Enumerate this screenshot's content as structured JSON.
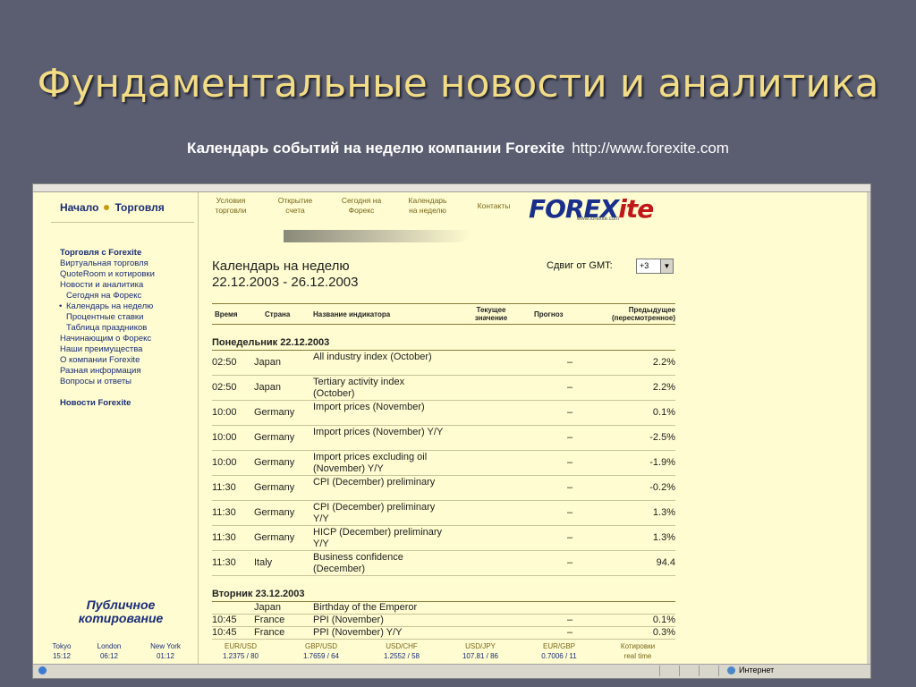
{
  "slide": {
    "title": "Фундаментальные новости и аналитика",
    "subtitle_bold": "Календарь событий на неделю компании Forexite",
    "subtitle_url": "http://www.forexite.com"
  },
  "site": {
    "topnav": [
      "Начало",
      "Торговля"
    ],
    "topmenu": [
      [
        "Условия",
        "торговли"
      ],
      [
        "Открытие",
        "счета"
      ],
      [
        "Сегодня на",
        "Форекс"
      ],
      [
        "Календарь",
        "на неделю"
      ],
      [
        "Контакты",
        ""
      ]
    ],
    "logo": {
      "main": "FOREX",
      "accent": "ite",
      "small": "www.forexite.com"
    },
    "leftmenu": [
      "Торговля с Forexite",
      "Виртуальная торговля",
      "QuoteRoom и котировки",
      "Новости и аналитика",
      "Сегодня на Форекс",
      "Календарь на неделю",
      "Процентные ставки",
      "Таблица праздников",
      "Начинающим о Форекс",
      "Наши преимущества",
      "О компании Forexite",
      "Разная информация",
      "Вопросы и ответы"
    ],
    "news_link": "Новости Forexite",
    "pub_quote": [
      "Публичное",
      "котирование"
    ],
    "page_title": "Календарь на неделю",
    "page_dates": "22.12.2003 - 26.12.2003",
    "gmt_label": "Сдвиг от GMT:",
    "gmt_value": "+3",
    "table_headers": {
      "time": "Время",
      "country": "Страна",
      "indicator": "Название индикатора",
      "current": [
        "Текущее",
        "значение"
      ],
      "forecast": "Прогноз",
      "previous": [
        "Предыдущее",
        "(пересмотренное)"
      ]
    },
    "days": [
      {
        "label": "Понедельник 22.12.2003",
        "rows": [
          {
            "time": "02:50",
            "country": "Japan",
            "indicator": "All industry index (October)",
            "forecast": "–",
            "previous": "2.2%"
          },
          {
            "time": "02:50",
            "country": "Japan",
            "indicator": "Tertiary activity index (October)",
            "forecast": "–",
            "previous": "2.2%"
          },
          {
            "time": "10:00",
            "country": "Germany",
            "indicator": "Import prices (November)",
            "forecast": "–",
            "previous": "0.1%"
          },
          {
            "time": "10:00",
            "country": "Germany",
            "indicator": "Import prices (November) Y/Y",
            "forecast": "–",
            "previous": "-2.5%"
          },
          {
            "time": "10:00",
            "country": "Germany",
            "indicator": "Import prices excluding oil (November) Y/Y",
            "forecast": "–",
            "previous": "-1.9%"
          },
          {
            "time": "11:30",
            "country": "Germany",
            "indicator": "CPI (December) preliminary",
            "forecast": "–",
            "previous": "-0.2%"
          },
          {
            "time": "11:30",
            "country": "Germany",
            "indicator": "CPI (December) preliminary Y/Y",
            "forecast": "–",
            "previous": "1.3%"
          },
          {
            "time": "11:30",
            "country": "Germany",
            "indicator": "HICP (December) preliminary Y/Y",
            "forecast": "–",
            "previous": "1.3%"
          },
          {
            "time": "11:30",
            "country": "Italy",
            "indicator": "Business confidence (December)",
            "forecast": "–",
            "previous": "94.4"
          }
        ]
      },
      {
        "label": "Вторник 23.12.2003",
        "rows": [
          {
            "time": "",
            "country": "Japan",
            "indicator": "Birthday of the Emperor",
            "forecast": "",
            "previous": ""
          },
          {
            "time": "10:45",
            "country": "France",
            "indicator": "PPI (November)",
            "forecast": "–",
            "previous": "0.1%"
          },
          {
            "time": "10:45",
            "country": "France",
            "indicator": "PPI (November) Y/Y",
            "forecast": "–",
            "previous": "0.3%"
          }
        ]
      }
    ],
    "cities": [
      {
        "name": "Tokyo",
        "time": "15:12"
      },
      {
        "name": "London",
        "time": "06:12"
      },
      {
        "name": "New York",
        "time": "01:12"
      }
    ],
    "pairs": [
      {
        "name": "EUR/USD",
        "value": "1.2375 / 80"
      },
      {
        "name": "GBP/USD",
        "value": "1.7659 / 64"
      },
      {
        "name": "USD/CHF",
        "value": "1.2552 / 58"
      },
      {
        "name": "USD/JPY",
        "value": "107.81 / 86"
      },
      {
        "name": "EUR/GBP",
        "value": "0.7006 / 11"
      },
      {
        "name": "Котировки",
        "value": "real time"
      }
    ]
  },
  "statusbar": {
    "zone": "Интернет"
  }
}
